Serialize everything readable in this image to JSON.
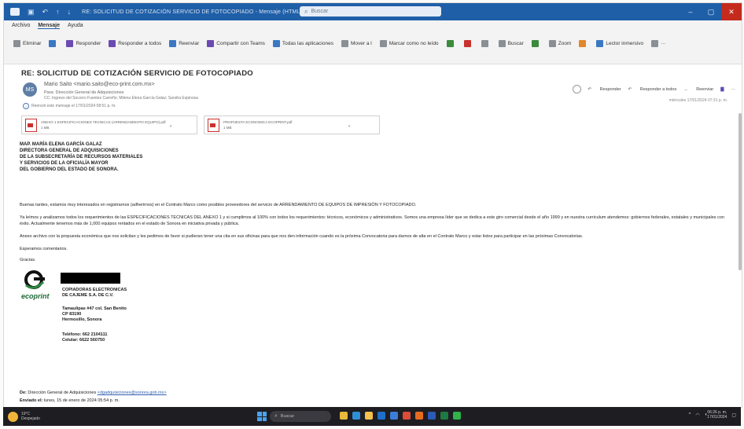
{
  "window": {
    "title": "RE: SOLICITUD DE COTIZACIÓN SERVICIO DE FOTOCOPIADO - Mensaje (HTML)",
    "search_placeholder": "Buscar"
  },
  "menu": {
    "items": [
      "Archivo",
      "Mensaje",
      "Ayuda"
    ],
    "active": "Mensaje"
  },
  "ribbon": {
    "items": [
      {
        "name": "delete-button",
        "label": "Eliminar",
        "icon": "trash-icon",
        "color": "#8a8f96"
      },
      {
        "name": "archive-button",
        "label": "",
        "icon": "archive-icon",
        "color": "#3b78c4"
      },
      {
        "name": "reply-button",
        "label": "Responder",
        "icon": "reply-icon",
        "color": "#6b4bb2"
      },
      {
        "name": "reply-all-button",
        "label": "Responder a todos",
        "icon": "reply-all-icon",
        "color": "#6b4bb2"
      },
      {
        "name": "forward-button",
        "label": "Reenviar",
        "icon": "forward-icon",
        "color": "#3b78c4"
      },
      {
        "name": "share-teams-button",
        "label": "Compartir con Teams",
        "icon": "teams-icon",
        "color": "#6b4bb2"
      },
      {
        "name": "all-apps-button",
        "label": "Todas las aplicaciones",
        "icon": "apps-icon",
        "color": "#3b78c4"
      },
      {
        "name": "move-button",
        "label": "Mover a l",
        "icon": "move-icon",
        "color": "#8a8f96"
      },
      {
        "name": "mark-read-button",
        "label": "Marcar como no leído",
        "icon": "mail-icon",
        "color": "#8a8f96"
      },
      {
        "name": "categorize-button",
        "label": "",
        "icon": "tag-icon",
        "color": "#3c8a3c"
      },
      {
        "name": "flag-button",
        "label": "",
        "icon": "flag-icon",
        "color": "#c8312c"
      },
      {
        "name": "policy-button",
        "label": "",
        "icon": "policy-icon",
        "color": "#8a8f96"
      },
      {
        "name": "find-button",
        "label": "Buscar",
        "icon": "search-icon",
        "color": "#8a8f96"
      },
      {
        "name": "select-button",
        "label": "",
        "icon": "select-icon",
        "color": "#3c8a3c"
      },
      {
        "name": "zoom-button",
        "label": "Zoom",
        "icon": "zoom-icon",
        "color": "#8a8f96"
      },
      {
        "name": "translate-button",
        "label": "",
        "icon": "translate-icon",
        "color": "#e3862c"
      },
      {
        "name": "immersive-reader-button",
        "label": "Lector inmersivo",
        "icon": "reader-icon",
        "color": "#3b78c4"
      },
      {
        "name": "more-button",
        "label": "···",
        "icon": "more-icon",
        "color": "#8a8f96"
      }
    ]
  },
  "message": {
    "subject": "RE: SOLICITUD DE COTIZACIÓN SERVICIO DE FOTOCOPIADO",
    "avatar_initials": "MS",
    "sender": "Mario Saito <mario.saito@eco-print.com.mx>",
    "to": "Para: Dirección General de Adquisiciones",
    "cc": "CC: Ingreso del Socorro Fuentes Carreño; Milena Elena García Galaz; Sandra Espinosa",
    "forwarded_note": "Reenvió este mensaje el 17/01/2024 08:51 p. m.",
    "actions": {
      "reply": "Responder",
      "reply_all": "Responder a todos",
      "forward": "Reenviar"
    },
    "date": "miércoles 17/01/2024 07:31 p. m.",
    "attachments": [
      {
        "name": "ANEXO 1 ESPECIFICACIONES TECNICAS (ARRENDAMIENTO EQUIPO).pdf",
        "size": "1 MB"
      },
      {
        "name": "PROPUESTA ECONOMICA ECOPRINT.pdf",
        "size": "1 MB"
      }
    ],
    "addressee": [
      "MAP. MARÍA ELENA GARCÍA GALAZ",
      "DIRECTORA GENERAL DE ADQUISICIONES",
      "DE LA SUBSECRETARÍA DE RECURSOS MATERIALES",
      "Y SERVICIOS DE LA OFICIALÍA MAYOR",
      "DEL GOBIERNO DEL ESTADO DE SONORA."
    ],
    "paragraphs": [
      "Buenas tardes, estamos muy interesados en registrarnos (adherirnos) en el Contrato Marco como posibles proveedores del servicio de ARRENDAMIENTO DE EQUIPOS DE IMPRESIÓN Y FOTOCOPIADO.",
      "Ya leímos y analizamos todos los requerimientos de las ESPECIFICACIONES TECNICAS DEL ANEXO 1 y si cumplimos al 100% con todos los requerimientos: técnicos, económicos y administrativos. Somos una empresa líder que se dedica a este giro comercial desde el año 1999 y en nuestra curriculum atendemos: gobiernos federales, estatales y municipales con éxito. Actualmente tenemos más de 1,000 equipos rentados en el estado de Sonora en iniciativa privada y pública.",
      "Anexo archivo con la propuesta económica que nos solicitan y les pedimos de favor si pudieran tener una cita en sus oficinas para que nos den información cuando es la próxima Convocatoria para darnos de alta en el Contrato Marco y estar listos para participar en las próximas Convocatorias.",
      "Esperamos comentarios.",
      "Gracias."
    ],
    "signature": {
      "logo_text": "ecoprint",
      "company": [
        "COPIADORAS ELECTRONICAS",
        "DE CAJEME S.A. DE C.V."
      ],
      "address": [
        "Tamaulipas #47 col. San Benito",
        "CP 83190",
        "Hermosillo, Sonora"
      ],
      "phones": [
        "Teléfono: 662 2104111",
        "Celular: 6622 560750"
      ]
    },
    "footer": {
      "from_label": "De:",
      "from_value": "Dirección General de Adquisiciones",
      "from_email": "<dgadquisiciones@sonora.gob.mx>",
      "sent_label": "Enviado el:",
      "sent_value": "lunes, 15 de enero de 2024 05:54 p. m."
    }
  },
  "taskbar": {
    "weather_temp": "19°C",
    "weather_desc": "Despejado",
    "search_placeholder": "Buscar",
    "time": "06:26 p. m.",
    "date": "17/01/2024",
    "apps": [
      {
        "name": "taskbar-app-file-explorer",
        "color": "#e8b93a"
      },
      {
        "name": "taskbar-app-edge",
        "color": "#2f8fd6"
      },
      {
        "name": "taskbar-app-folder",
        "color": "#f2c14e"
      },
      {
        "name": "taskbar-app-outlook",
        "color": "#1f6fc9"
      },
      {
        "name": "taskbar-app-store",
        "color": "#3b7dd8"
      },
      {
        "name": "taskbar-app-chrome",
        "color": "#dd4b39"
      },
      {
        "name": "taskbar-app-firefox",
        "color": "#e66b1f"
      },
      {
        "name": "taskbar-app-word",
        "color": "#2b5ab8"
      },
      {
        "name": "taskbar-app-excel",
        "color": "#1e7a44"
      },
      {
        "name": "taskbar-app-whatsapp",
        "color": "#2fb34a"
      }
    ]
  }
}
